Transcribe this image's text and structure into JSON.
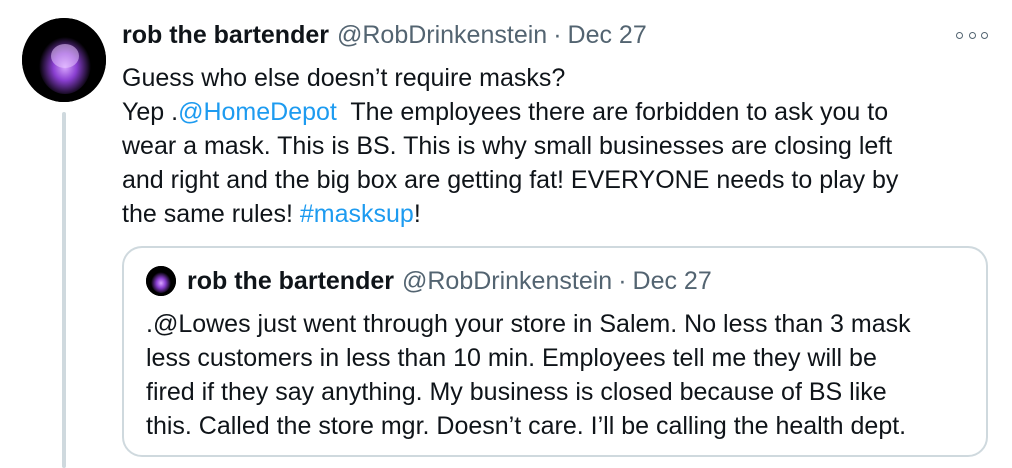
{
  "tweet": {
    "author_name": "rob the bartender",
    "author_handle": "@RobDrinkenstein",
    "separator": "·",
    "date": "Dec 27",
    "more_icon": "more-horizontal-icon",
    "text": {
      "line1": "Guess who else doesn’t require masks?",
      "line2_prefix": "Yep .",
      "line2_mention": "@HomeDepot",
      "line2_suffix": "  The employees there are forbidden to ask you to",
      "line3": "wear a mask. This is BS. This is why small businesses are closing left",
      "line4": "and right and the big box are getting fat! EVERYONE needs to play by",
      "line5_prefix": "the same rules! ",
      "line5_hashtag": "#masksup",
      "line5_suffix": "!"
    }
  },
  "quoted_tweet": {
    "author_name": "rob the bartender",
    "author_handle": "@RobDrinkenstein",
    "separator": "·",
    "date": "Dec 27",
    "text": {
      "line1": ".@Lowes just went through your store in Salem. No less than 3 mask",
      "line2": "less customers in less than 10 min. Employees tell me they will be",
      "line3": "fired if they say anything. My business is closed because of BS like",
      "line4": "this. Called the store mgr. Doesn’t care. I’ll be calling the health dept."
    }
  },
  "colors": {
    "text": "#0f1419",
    "secondary": "#536471",
    "link": "#1d9bf0",
    "border": "#cfd9de"
  }
}
